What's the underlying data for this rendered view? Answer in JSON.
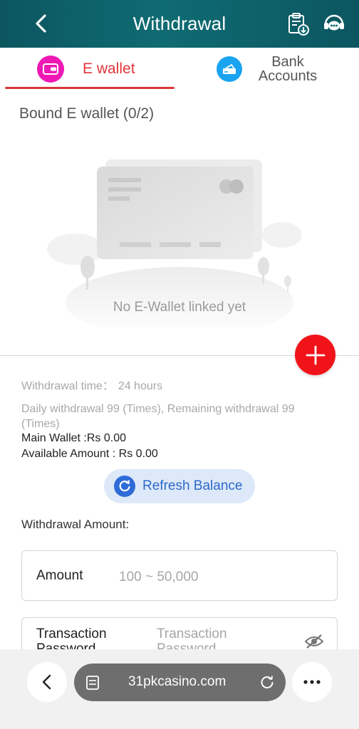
{
  "header": {
    "title": "Withdrawal",
    "back_icon": "chevron-left-icon",
    "record_icon": "clipboard-download-icon",
    "support_icon": "customer-service-icon"
  },
  "tabs": [
    {
      "label": "E wallet",
      "icon": "wallet-icon",
      "active": true
    },
    {
      "label_line1": "Bank",
      "label_line2": "Accounts",
      "icon": "bank-card-icon",
      "active": false
    }
  ],
  "bound": {
    "title": "Bound E wallet (0/2)",
    "empty_text": "No E-Wallet linked yet"
  },
  "info": {
    "withdrawal_time_label": "Withdrawal time：",
    "withdrawal_time_value": "24 hours",
    "daily_line1": "Daily withdrawal 99 (Times), Remaining withdrawal 99",
    "daily_line2": "(Times)",
    "main_wallet": "Main Wallet :Rs 0.00",
    "available_amount": "Available Amount : Rs 0.00"
  },
  "refresh": {
    "label": "Refresh Balance",
    "icon": "refresh-icon"
  },
  "form": {
    "withdrawal_amount_label": "Withdrawal Amount:",
    "amount_label": "Amount",
    "amount_placeholder": "100 ~ 50,000",
    "password_label_line1": "Transaction",
    "password_label_line2": "Password",
    "password_placeholder_line1": "Transaction",
    "password_placeholder_line2": "Password",
    "password_icon": "eye-hidden-icon"
  },
  "browser": {
    "url": "31pkcasino.com",
    "back_icon": "chevron-left-icon",
    "tabs_icon": "page-icon",
    "reload_icon": "reload-icon",
    "more_icon": "more-icon"
  },
  "colors": {
    "header_bg": "#0f6b72",
    "active_tab": "#e2353b",
    "add_button": "#f0141a",
    "refresh_bg": "#dde9f9",
    "refresh_text": "#2e68c9"
  }
}
